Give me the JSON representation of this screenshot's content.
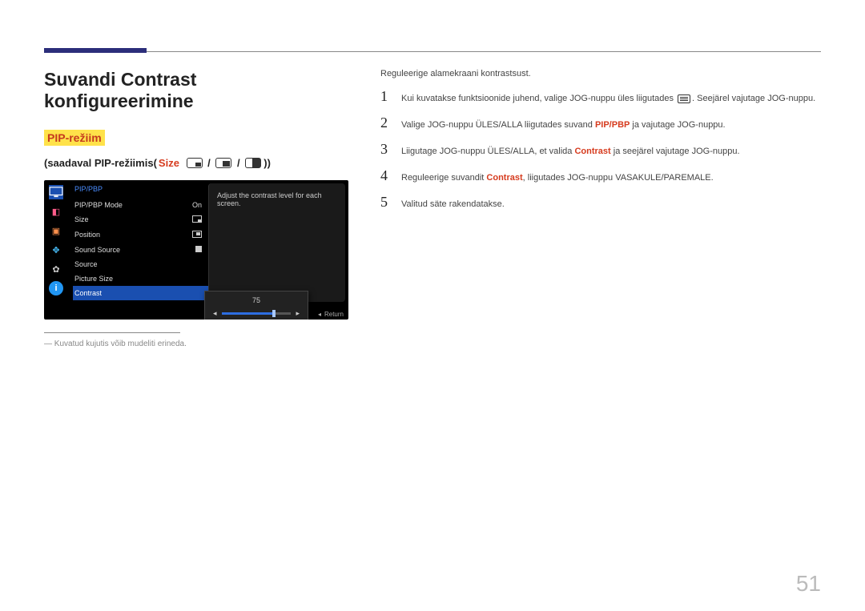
{
  "heading": "Suvandi Contrast konfigureerimine",
  "badge": "PIP-režiim",
  "subtitle_prefix": "(saadaval PIP-režiimis(",
  "subtitle_size": "Size",
  "subtitle_suffix": "))",
  "osd": {
    "title": "PIP/PBP",
    "rows": [
      {
        "label": "PIP/PBP Mode",
        "value": "On"
      },
      {
        "label": "Size",
        "value": ""
      },
      {
        "label": "Position",
        "value": ""
      },
      {
        "label": "Sound Source",
        "value": ""
      },
      {
        "label": "Source",
        "value": ""
      },
      {
        "label": "Picture Size",
        "value": ""
      },
      {
        "label": "Contrast",
        "value": ""
      }
    ],
    "side_text": "Adjust the contrast level for each screen.",
    "slider_value": "75",
    "return": "Return"
  },
  "footnote": "Kuvatud kujutis võib mudeliti erineda.",
  "desc": "Reguleerige alamekraani kontrastsust.",
  "steps": [
    {
      "n": "1",
      "pre": "Kui kuvatakse funktsioonide juhend, valige JOG-nuppu üles liigutades ",
      "icon": true,
      "post": ". Seejärel vajutage JOG-nuppu."
    },
    {
      "n": "2",
      "pre": "Valige JOG-nuppu ÜLES/ALLA liigutades suvand ",
      "hl": "PIP/PBP",
      "post": " ja vajutage JOG-nuppu."
    },
    {
      "n": "3",
      "pre": "Liigutage JOG-nuppu ÜLES/ALLA, et valida ",
      "hl": "Contrast",
      "post": " ja seejärel vajutage JOG-nuppu."
    },
    {
      "n": "4",
      "pre": "Reguleerige suvandit ",
      "hl": "Contrast",
      "post": ", liigutades JOG-nuppu VASAKULE/PAREMALE."
    },
    {
      "n": "5",
      "pre": "Valitud säte rakendatakse.",
      "hl": "",
      "post": ""
    }
  ],
  "page_number": "51"
}
